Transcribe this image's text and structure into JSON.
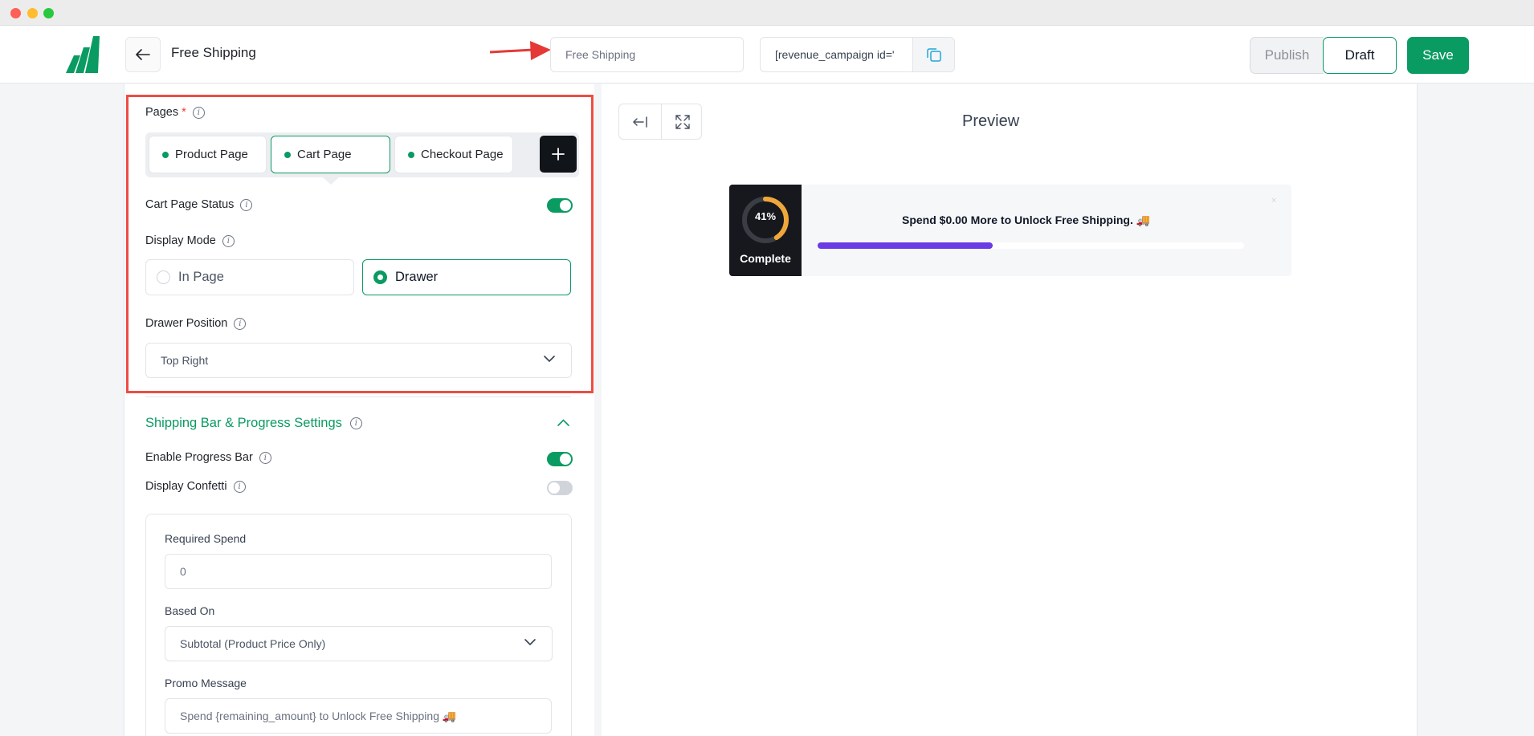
{
  "header": {
    "title": "Free Shipping",
    "name_input_value": "Free Shipping",
    "shortcode": "[revenue_campaign id='",
    "publish_label": "Publish",
    "draft_label": "Draft",
    "save_label": "Save"
  },
  "pages": {
    "label": "Pages",
    "required_mark": "*",
    "tabs": [
      {
        "label": "Product Page"
      },
      {
        "label": "Cart Page",
        "active": true
      },
      {
        "label": "Checkout Page"
      }
    ]
  },
  "cart_page_status": {
    "label": "Cart Page Status",
    "enabled": true
  },
  "display_mode": {
    "label": "Display Mode",
    "options": [
      {
        "label": "In Page",
        "selected": false
      },
      {
        "label": "Drawer",
        "selected": true
      }
    ]
  },
  "drawer_position": {
    "label": "Drawer Position",
    "value": "Top Right"
  },
  "shipping_section": {
    "title": "Shipping Bar & Progress Settings",
    "enable_progress_bar": {
      "label": "Enable Progress Bar",
      "enabled": true
    },
    "display_confetti": {
      "label": "Display Confetti",
      "enabled": false
    },
    "required_spend": {
      "label": "Required Spend",
      "value": "0"
    },
    "based_on": {
      "label": "Based On",
      "value": "Subtotal (Product Price Only)"
    },
    "promo_message": {
      "label": "Promo Message",
      "value": "Spend {remaining_amount} to Unlock Free Shipping 🚚"
    }
  },
  "preview": {
    "title": "Preview",
    "percent_label": "41%",
    "percent": 41,
    "complete_label": "Complete",
    "message": "Spend $0.00 More to Unlock Free Shipping. 🚚",
    "close": "×"
  },
  "colors": {
    "accent": "#0a9b62",
    "progress": "#6b3be6",
    "ring": "#f0a73a",
    "highlight": "#ec4d45"
  }
}
